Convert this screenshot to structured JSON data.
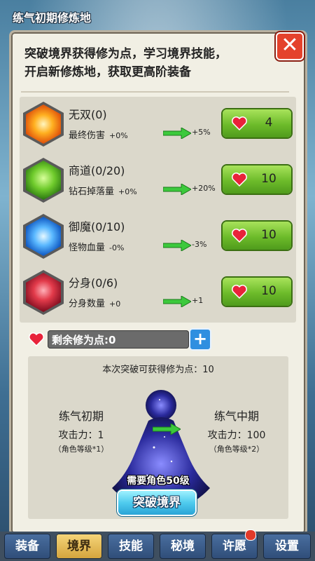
{
  "header": {
    "title": "练气初期修炼地"
  },
  "dialog": {
    "intro_line1": "突破境界获得修为点，学习境界技能，",
    "intro_line2": "开启新修炼地，获取更高阶装备"
  },
  "skills": [
    {
      "name": "无双(0)",
      "stat": "最终伤害",
      "current": "+0%",
      "next": "+5%",
      "cost": "4",
      "icon": "fire-burst-icon",
      "color": "#f59a1a"
    },
    {
      "name": "商道(0/20)",
      "stat": "钻石掉落量",
      "current": "+0%",
      "next": "+20%",
      "cost": "10",
      "icon": "green-gem-icon",
      "color": "#4aa02a"
    },
    {
      "name": "御魔(0/10)",
      "stat": "怪物血量",
      "current": "-0%",
      "next": "-3%",
      "cost": "10",
      "icon": "lightning-icon",
      "color": "#2a8fe8"
    },
    {
      "name": "分身(0/6)",
      "stat": "分身数量",
      "current": "+0",
      "next": "+1",
      "cost": "10",
      "icon": "demon-face-icon",
      "color": "#c0263a"
    }
  ],
  "remaining": {
    "label": "剩余修为点:0"
  },
  "breakthrough": {
    "gain_text": "本次突破可获得修为点：10",
    "current_stage": {
      "name": "练气初期",
      "attack": "攻击力：1",
      "level": "（角色等级*1）"
    },
    "next_stage": {
      "name": "练气中期",
      "attack": "攻击力：100",
      "level": "（角色等级*2）"
    },
    "requirement": "需要角色50级",
    "button_label": "突破境界"
  },
  "tabs": [
    {
      "label": "装备",
      "active": false
    },
    {
      "label": "境界",
      "active": true
    },
    {
      "label": "技能",
      "active": false
    },
    {
      "label": "秘境",
      "active": false
    },
    {
      "label": "许愿",
      "active": false,
      "badge": true
    },
    {
      "label": "设置",
      "active": false
    }
  ]
}
